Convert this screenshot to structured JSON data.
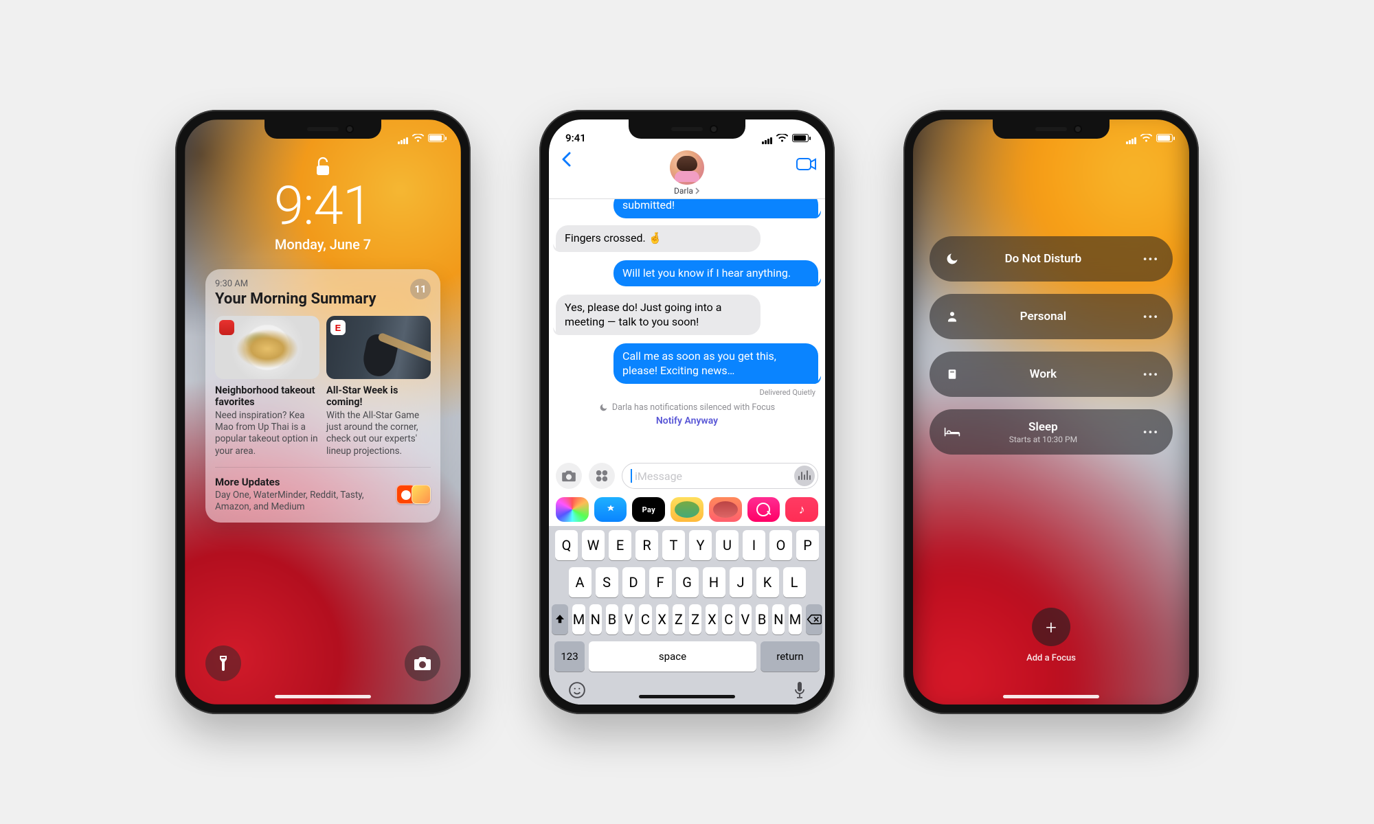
{
  "status": {
    "time": "9:41"
  },
  "lockscreen": {
    "time": "9:41",
    "date": "Monday, June 7",
    "summary": {
      "timestamp": "9:30 AM",
      "title": "Your Morning Summary",
      "badge": "11",
      "stories": [
        {
          "headline": "Neighborhood takeout favorites",
          "body": "Need inspiration? Kea Mao from Up Thai is a popular takeout option in your area."
        },
        {
          "headline": "All-Star Week is coming!",
          "body": "With the All-Star Game just around the corner, check out our experts' lineup projections."
        }
      ],
      "more": {
        "title": "More Updates",
        "body": "Day One, WaterMinder, Reddit, Tasty, Amazon, and Medium"
      }
    }
  },
  "messages": {
    "contact_name": "Darla",
    "thread": [
      {
        "dir": "out",
        "text": "submitted!"
      },
      {
        "dir": "in",
        "text": "Fingers crossed. 🤞"
      },
      {
        "dir": "out",
        "text": "Will let you know if I hear anything."
      },
      {
        "dir": "in",
        "text": "Yes, please do! Just going into a meeting — talk to you soon!"
      },
      {
        "dir": "out",
        "text": "Call me as soon as you get this, please! Exciting news…"
      }
    ],
    "delivery_status": "Delivered Quietly",
    "focus_note": "Darla has notifications silenced with Focus",
    "notify_anyway": "Notify Anyway",
    "input_placeholder": "iMessage",
    "app_strip": {
      "applepay_label": "Pay"
    },
    "keyboard": {
      "row1": [
        "Q",
        "W",
        "E",
        "R",
        "T",
        "Y",
        "U",
        "I",
        "O",
        "P"
      ],
      "row2": [
        "A",
        "S",
        "D",
        "F",
        "G",
        "H",
        "J",
        "K",
        "L"
      ],
      "row3": [
        "Z",
        "X",
        "C",
        "V",
        "B",
        "N",
        "M"
      ],
      "mode": "123",
      "space": "space",
      "return": "return"
    }
  },
  "focus": {
    "modes": [
      {
        "name": "Do Not Disturb",
        "icon": "moon",
        "sub": ""
      },
      {
        "name": "Personal",
        "icon": "person",
        "sub": ""
      },
      {
        "name": "Work",
        "icon": "badge",
        "sub": ""
      },
      {
        "name": "Sleep",
        "icon": "bed",
        "sub": "Starts at 10:30 PM"
      }
    ],
    "add_label": "Add a Focus"
  }
}
